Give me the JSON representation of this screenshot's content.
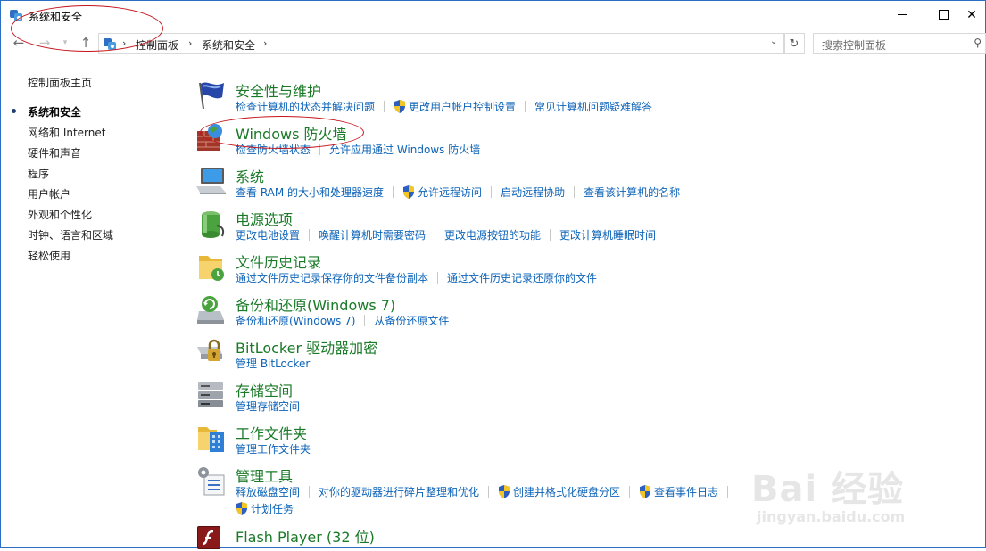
{
  "window": {
    "title": "系统和安全"
  },
  "address": {
    "crumbs": [
      "控制面板",
      "系统和安全"
    ],
    "search_placeholder": "搜索控制面板"
  },
  "leftnav": {
    "items": [
      {
        "label": "控制面板主页"
      },
      {
        "label": "系统和安全",
        "current": true
      },
      {
        "label": "网络和 Internet"
      },
      {
        "label": "硬件和声音"
      },
      {
        "label": "程序"
      },
      {
        "label": "用户帐户"
      },
      {
        "label": "外观和个性化"
      },
      {
        "label": "时钟、语言和区域"
      },
      {
        "label": "轻松使用"
      }
    ]
  },
  "categories": [
    {
      "title": "安全性与维护",
      "icon": "flag-icon",
      "links": [
        {
          "label": "检查计算机的状态并解决问题"
        },
        {
          "label": "更改用户帐户控制设置",
          "shield": true
        },
        {
          "label": "常见计算机问题疑难解答"
        }
      ]
    },
    {
      "title": "Windows 防火墙",
      "icon": "firewall-icon",
      "links": [
        {
          "label": "检查防火墙状态"
        },
        {
          "label": "允许应用通过 Windows 防火墙"
        }
      ]
    },
    {
      "title": "系统",
      "icon": "computer-icon",
      "links": [
        {
          "label": "查看 RAM 的大小和处理器速度"
        },
        {
          "label": "允许远程访问",
          "shield": true
        },
        {
          "label": "启动远程协助"
        },
        {
          "label": "查看该计算机的名称"
        }
      ]
    },
    {
      "title": "电源选项",
      "icon": "battery-icon",
      "links": [
        {
          "label": "更改电池设置"
        },
        {
          "label": "唤醒计算机时需要密码"
        },
        {
          "label": "更改电源按钮的功能"
        },
        {
          "label": "更改计算机睡眠时间"
        }
      ]
    },
    {
      "title": "文件历史记录",
      "icon": "file-history-icon",
      "links": [
        {
          "label": "通过文件历史记录保存你的文件备份副本"
        },
        {
          "label": "通过文件历史记录还原你的文件"
        }
      ]
    },
    {
      "title": "备份和还原(Windows 7)",
      "icon": "backup-icon",
      "links": [
        {
          "label": "备份和还原(Windows 7)"
        },
        {
          "label": "从备份还原文件"
        }
      ]
    },
    {
      "title": "BitLocker 驱动器加密",
      "icon": "bitlocker-icon",
      "links": [
        {
          "label": "管理 BitLocker"
        }
      ]
    },
    {
      "title": "存储空间",
      "icon": "storage-icon",
      "links": [
        {
          "label": "管理存储空间"
        }
      ]
    },
    {
      "title": "工作文件夹",
      "icon": "work-folders-icon",
      "links": [
        {
          "label": "管理工作文件夹"
        }
      ]
    },
    {
      "title": "管理工具",
      "icon": "admin-tools-icon",
      "links": [
        {
          "label": "释放磁盘空间"
        },
        {
          "label": "对你的驱动器进行碎片整理和优化"
        },
        {
          "label": "创建并格式化硬盘分区",
          "shield": true
        },
        {
          "label": "查看事件日志",
          "shield": true
        }
      ],
      "links2": [
        {
          "label": "计划任务",
          "shield": true
        }
      ]
    },
    {
      "title": "Flash Player (32 位)",
      "icon": "flash-icon",
      "links": []
    }
  ],
  "watermark": {
    "brand": "Bai 经验",
    "url": "jingyan.baidu.com"
  },
  "colors": {
    "category_title": "#1a7a28",
    "link": "#0d63b8",
    "annotation": "#c4141c"
  }
}
